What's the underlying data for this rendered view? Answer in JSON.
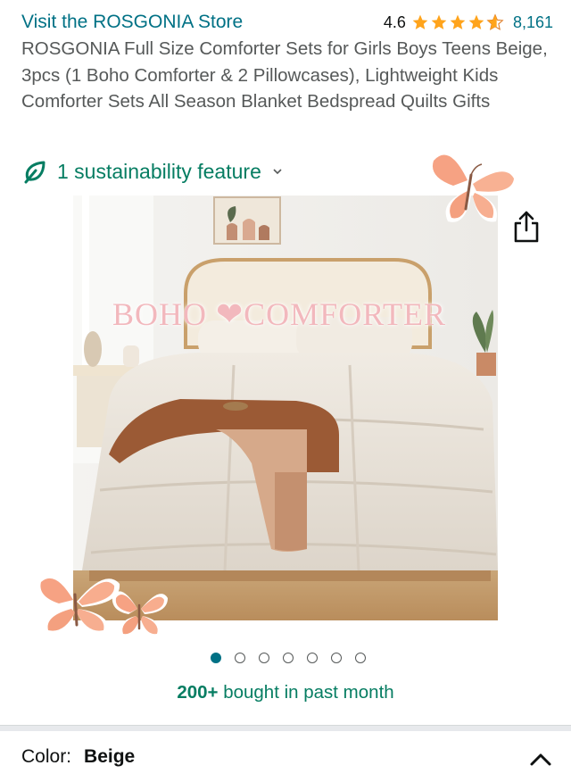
{
  "store": {
    "link_text": "Visit the ROSGONIA Store",
    "rating": "4.6",
    "rating_value": 4.6,
    "rating_count": "8,161",
    "star_color": "#ffa41c"
  },
  "product": {
    "title": "ROSGONIA Full Size Comforter Sets for Girls Boys Teens Beige, 3pcs (1 Boho Comforter & 2 Pillowcases), Lightweight Kids Comforter Sets All Season Blanket Bedspread Quilts Gifts"
  },
  "sustainability": {
    "label": "1 sustainability feature",
    "icon": "leaf-icon",
    "color": "#067d62"
  },
  "image": {
    "overlay_text": "BOHO ❤COMFORTER",
    "decorations": [
      "butterfly",
      "butterfly",
      "butterfly"
    ]
  },
  "carousel": {
    "total": 7,
    "active_index": 0
  },
  "social_proof": {
    "count": "200+",
    "text": " bought in past month"
  },
  "variation": {
    "label": "Color:",
    "value": "Beige"
  },
  "colors": {
    "link": "#007185",
    "accent_green": "#067d62"
  }
}
